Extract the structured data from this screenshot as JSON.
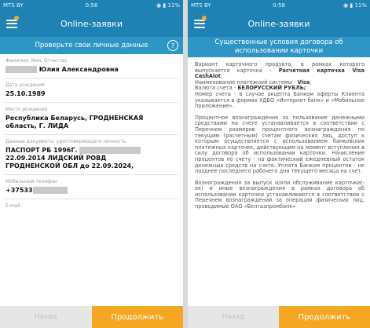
{
  "left_screen": {
    "status": {
      "carrier": "MTS BY",
      "time": "0:56",
      "battery": "11%"
    },
    "title": "Online-заявки",
    "subtitle": "Проверьте свои личные данные",
    "help_icon": "?",
    "fields": [
      {
        "label": "Фамилия, Имя, Отчество",
        "value": "Юлия Александровна"
      },
      {
        "label": "Дата рождения",
        "value": "25.10.1989"
      },
      {
        "label": "Место рождения",
        "value": "Республика Беларусь, ГРОДНЕНСКАЯ\nобласть, Г. ЛИДА"
      },
      {
        "label": "Данные документа, удостоверяющего личность",
        "value_line1": "ПАСПОРТ РБ 1996Г.",
        "value_rest": "22.09.2014 ЛИДСКИЙ РОВД\nГРОДНЕНСКОЙ ОБЛ до 22.09.2024,"
      },
      {
        "label": "Мобильный телефон",
        "value": "+37533"
      },
      {
        "label": "E-mail",
        "value": ""
      }
    ],
    "back_label": "Назад",
    "next_label": "Продолжить"
  },
  "right_screen": {
    "status": {
      "carrier": "MTS BY",
      "time": "0:58",
      "battery": "11%"
    },
    "title": "Online-заявки",
    "subtitle_line1": "Существенные условия договора об",
    "subtitle_line2": "использовании карточки",
    "para1_a": "Вариант карточного продукта, в рамках которого выпускается карточка - ",
    "para1_b": "Расчетная карточка Visa CashAlot",
    "para1_c": ";\nНаименование платежной системы - ",
    "para1_d": "Visa",
    "para1_e": ";\nВалюта счета - ",
    "para1_f": "БЕЛОРУССКИЙ РУБЛЬ;",
    "para1_g": "\nНомер счета - в случае акцепта Банком оферты Клиента указывается в формах УДБО «Интернет-банк» и «Мобильное приложение».",
    "para2": "Процентное вознаграждение за пользование денежными средствами на счете устанавливается в соответствии с Перечнем размеров процентного вознаграждения по текущим (расчетным) счетам физических лиц, доступ к которым осуществляется с использованием банковских платежных карточек, действующим на момент вступления в силу договора об использовании карточки. Начисление процентов по счету - на фактический ежедневный остаток денежных средств на счете. Уплата Банком процентов - не позднее последнего рабочего дня текущего месяца на счет.",
    "para3": "Вознаграждения за выпуск и/или обслуживание карточки(-ек) и иные вознаграждения в рамках договора об использовании карточки устанавливаются в соответствии с Перечнем вознаграждений за операции физических лиц, проводимые ОАО «Белгазпромбанк»",
    "back_label": "Назад",
    "next_label": "Продолжить"
  },
  "colors": {
    "primary": "#1e82b5",
    "secondary": "#2e96c4",
    "accent": "#f5a623",
    "disabled": "#e6e6e6"
  },
  "icons": [
    "menu-icon",
    "notification-dot-icon",
    "help-icon",
    "wifi-icon",
    "battery-icon"
  ]
}
